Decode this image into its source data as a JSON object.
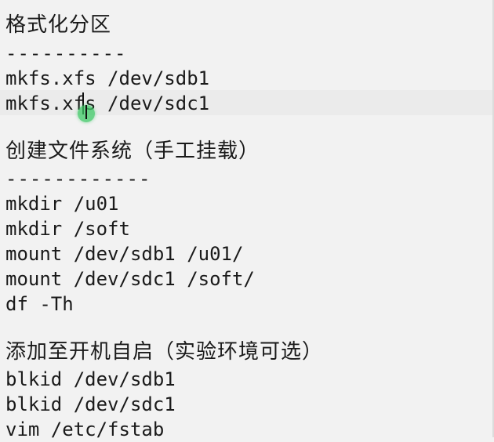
{
  "editor": {
    "lines": [
      "格式化分区",
      "----------",
      "mkfs.xfs /dev/sdb1",
      "mkfs.xfs /dev/sdc1",
      "",
      "创建文件系统（手工挂载）",
      "------------",
      "mkdir /u01",
      "mkdir /soft",
      "mount /dev/sdb1 /u01/",
      "mount /dev/sdc1 /soft/",
      "df -Th",
      "",
      "添加至开机自启（实验环境可选）",
      "blkid /dev/sdb1",
      "blkid /dev/sdc1",
      "vim /etc/fstab"
    ]
  }
}
